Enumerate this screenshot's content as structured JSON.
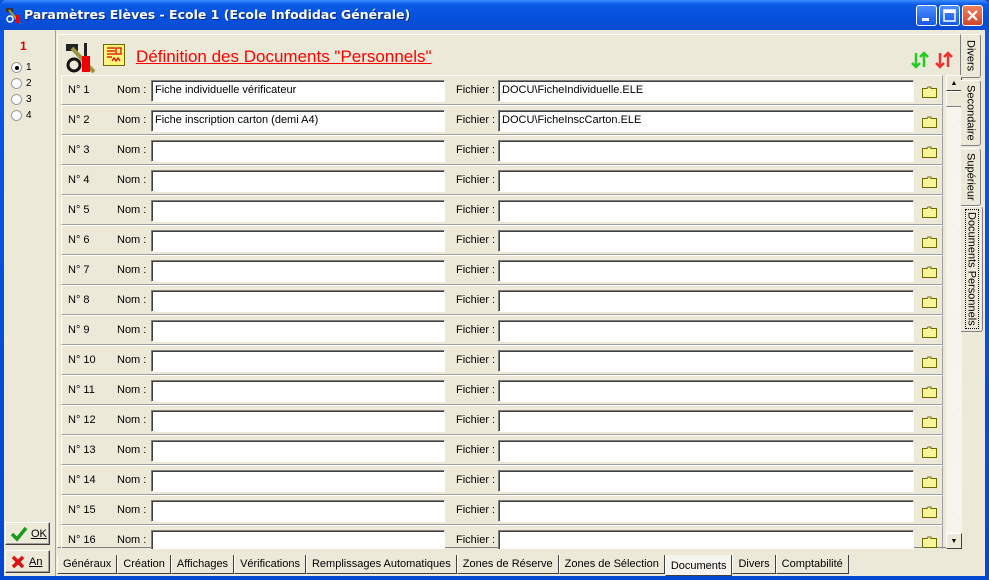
{
  "window": {
    "title": "Paramètres Elèves - Ecole 1 (Ecole Infodidac Générale)",
    "controls": [
      "minimize",
      "maximize",
      "close"
    ]
  },
  "left_panel": {
    "selected_number": "1",
    "radios": [
      {
        "label": "1",
        "checked": true
      },
      {
        "label": "2",
        "checked": false
      },
      {
        "label": "3",
        "checked": false
      },
      {
        "label": "4",
        "checked": false
      }
    ],
    "ok_label": "OK",
    "cancel_label": "An"
  },
  "header": {
    "title": "Définition des Documents \"Personnels\"",
    "sort_asc_icon": "sort-green-arrows-icon",
    "sort_desc_icon": "sort-red-arrows-icon"
  },
  "labels": {
    "nom": "Nom :",
    "fichier": "Fichier :"
  },
  "documents": [
    {
      "num": "N° 1",
      "nom": "Fiche individuelle vérificateur",
      "fichier": "DOCU\\FicheIndividuelle.ELE"
    },
    {
      "num": "N° 2",
      "nom": "Fiche inscription carton (demi A4)",
      "fichier": "DOCU\\FicheInscCarton.ELE"
    },
    {
      "num": "N° 3",
      "nom": "",
      "fichier": ""
    },
    {
      "num": "N° 4",
      "nom": "",
      "fichier": ""
    },
    {
      "num": "N° 5",
      "nom": "",
      "fichier": ""
    },
    {
      "num": "N° 6",
      "nom": "",
      "fichier": ""
    },
    {
      "num": "N° 7",
      "nom": "",
      "fichier": ""
    },
    {
      "num": "N° 8",
      "nom": "",
      "fichier": ""
    },
    {
      "num": "N° 9",
      "nom": "",
      "fichier": ""
    },
    {
      "num": "N° 10",
      "nom": "",
      "fichier": ""
    },
    {
      "num": "N° 11",
      "nom": "",
      "fichier": ""
    },
    {
      "num": "N° 12",
      "nom": "",
      "fichier": ""
    },
    {
      "num": "N° 13",
      "nom": "",
      "fichier": ""
    },
    {
      "num": "N° 14",
      "nom": "",
      "fichier": ""
    },
    {
      "num": "N° 15",
      "nom": "",
      "fichier": ""
    },
    {
      "num": "N° 16",
      "nom": "",
      "fichier": ""
    }
  ],
  "vertical_tabs": [
    {
      "label": "Divers",
      "active": false
    },
    {
      "label": "Secondaire",
      "active": false
    },
    {
      "label": "Supérieur",
      "active": false
    },
    {
      "label": "Documents Personnels",
      "active": true
    }
  ],
  "bottom_tabs": [
    {
      "label": "Généraux",
      "active": false
    },
    {
      "label": "Création",
      "active": false
    },
    {
      "label": "Affichages",
      "active": false
    },
    {
      "label": "Vérifications",
      "active": false
    },
    {
      "label": "Remplissages Automatiques",
      "active": false
    },
    {
      "label": "Zones de Réserve",
      "active": false
    },
    {
      "label": "Zones de Sélection",
      "active": false
    },
    {
      "label": "Documents",
      "active": true
    },
    {
      "label": "Divers",
      "active": false
    },
    {
      "label": "Comptabilité",
      "active": false
    }
  ],
  "colors": {
    "title_red": "#ff0000",
    "sort_green": "#22cc22",
    "sort_red": "#ee3333",
    "folder_yellow": "#f8f49a"
  }
}
